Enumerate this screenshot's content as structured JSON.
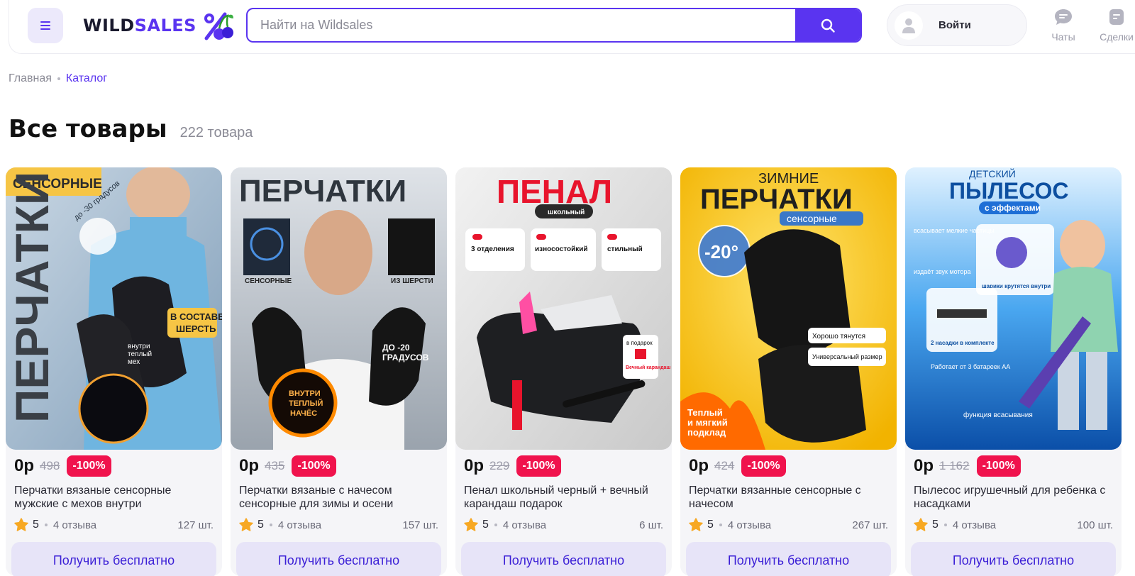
{
  "header": {
    "logo_wild": "WILD",
    "logo_sales": "SALES",
    "search_placeholder": "Найти на Wildsales",
    "login_label": "Войти",
    "chats_label": "Чаты",
    "deals_label": "Сделки"
  },
  "breadcrumb": {
    "home": "Главная",
    "current": "Каталог"
  },
  "page": {
    "title": "Все товары",
    "count": "222 товара"
  },
  "colors": {
    "accent": "#5a34f0",
    "discount": "#f0134d",
    "cta_bg": "#e7e4f8"
  },
  "products": [
    {
      "image_text": [
        "СЕНСОРНЫЕ",
        "ПЕРЧАТКИ",
        "до -30 градусов",
        "В СОСТАВЕ",
        "ШЕРСТЬ",
        "внутри",
        "теплый",
        "мех"
      ],
      "price": "0р",
      "old_price": "498",
      "discount": "-100%",
      "name": "Перчатки вязаные сенсорные мужские с мехов внутри",
      "rating": "5",
      "reviews": "4 отзыва",
      "stock": "127 шт.",
      "cta": "Получить бесплатно"
    },
    {
      "image_text": [
        "ПЕРЧАТКИ",
        "СЕНСОРНЫЕ",
        "ИЗ ШЕРСТИ",
        "ДО -20",
        "ГРАДУСОВ",
        "ВНУТРИ",
        "ТЕПЛЫЙ",
        "НАЧЁС"
      ],
      "price": "0р",
      "old_price": "435",
      "discount": "-100%",
      "name": "Перчатки вязаные с начесом сенсорные для зимы и осени",
      "rating": "5",
      "reviews": "4 отзыва",
      "stock": "157 шт.",
      "cta": "Получить бесплатно"
    },
    {
      "image_text": [
        "ПЕНАЛ",
        "школьный",
        "3 отделения",
        "износостойкий",
        "стильный",
        "в подарок",
        "Вечный карандаш"
      ],
      "price": "0р",
      "old_price": "229",
      "discount": "-100%",
      "name": "Пенал школьный черный + вечный карандаш подарок",
      "rating": "5",
      "reviews": "4 отзыва",
      "stock": "6 шт.",
      "cta": "Получить бесплатно"
    },
    {
      "image_text": [
        "ЗИМНИЕ",
        "ПЕРЧАТКИ",
        "сенсорные",
        "-20°",
        "Хорошо тянутся",
        "Универсальный размер",
        "Теплый",
        "и мягкий",
        "подклад"
      ],
      "price": "0р",
      "old_price": "424",
      "discount": "-100%",
      "name": "Перчатки вязанные сенсорные с начесом",
      "rating": "5",
      "reviews": "4 отзыва",
      "stock": "267 шт.",
      "cta": "Получить бесплатно"
    },
    {
      "image_text": [
        "ДЕТСКИЙ",
        "ПЫЛЕСОС",
        "с эффектами",
        "всасывает мелкие частицы",
        "издаёт звук мотора",
        "шарики крутятся внутри",
        "2 насадки в комплекте",
        "Работает от 3 батареек АА",
        "функция всасывания"
      ],
      "price": "0р",
      "old_price": "1 162",
      "discount": "-100%",
      "name": "Пылесос игрушечный для ребенка с насадками",
      "rating": "5",
      "reviews": "4 отзыва",
      "stock": "100 шт.",
      "cta": "Получить бесплатно"
    }
  ]
}
